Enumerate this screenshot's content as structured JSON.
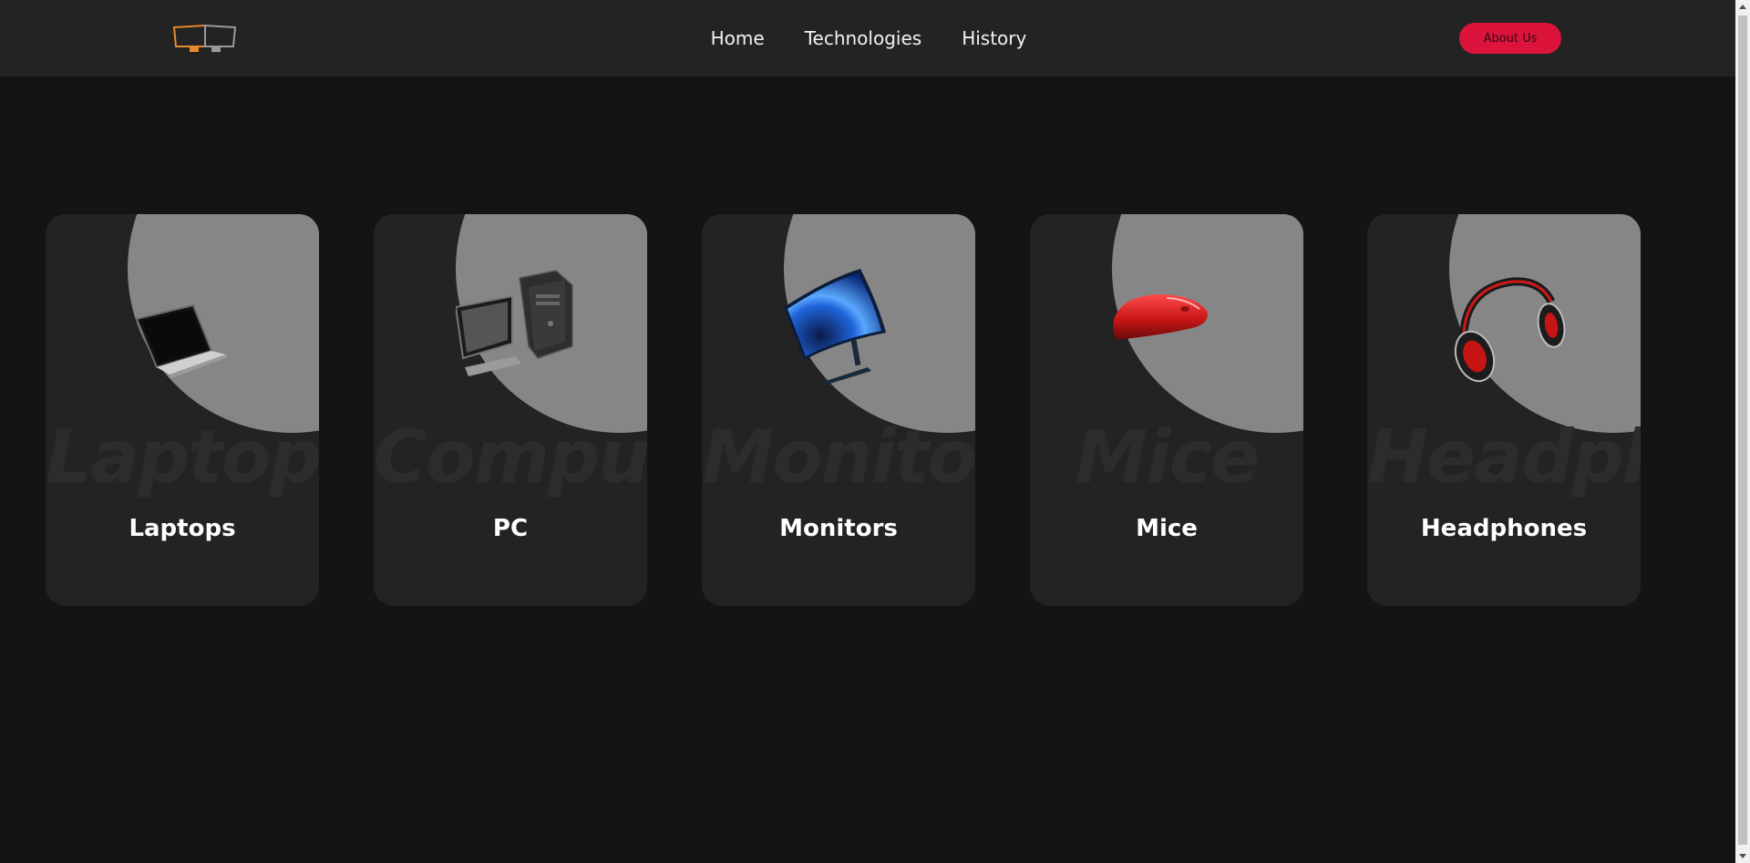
{
  "nav": {
    "logo": "monitors-logo-icon",
    "links": [
      "Home",
      "Technologies",
      "History"
    ],
    "about_label": "About Us",
    "accent": "#dc143c"
  },
  "cards": [
    {
      "title": "Laptops",
      "ghost": "Laptops",
      "icon": "laptop-icon"
    },
    {
      "title": "PC",
      "ghost": "Computer",
      "icon": "desktop-pc-icon"
    },
    {
      "title": "Monitors",
      "ghost": "Monitors",
      "icon": "monitor-icon"
    },
    {
      "title": "Mice",
      "ghost": "Mice",
      "icon": "mouse-icon"
    },
    {
      "title": "Headphones",
      "ghost": "Headphones",
      "icon": "headphones-icon"
    }
  ],
  "colors": {
    "background": "#141414",
    "surface": "#232323",
    "circle": "#868686"
  }
}
